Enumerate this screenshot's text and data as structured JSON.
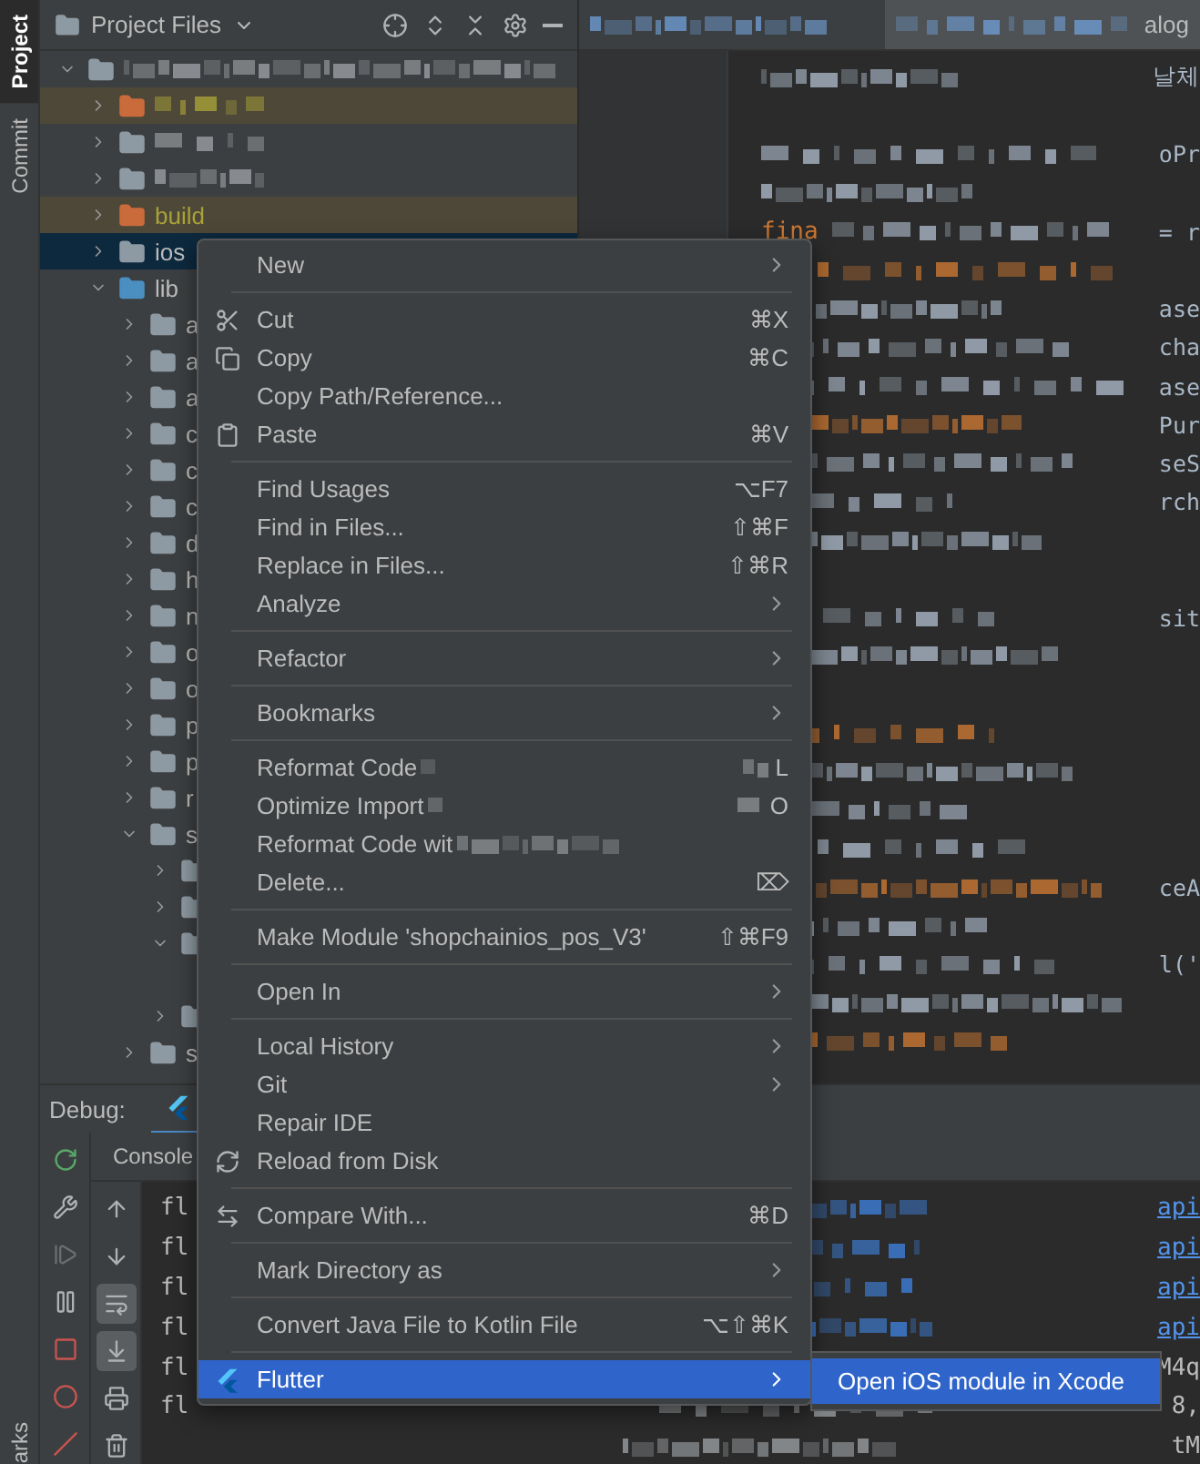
{
  "tool_stripe": {
    "tabs": [
      {
        "label": "Project",
        "selected": true
      },
      {
        "label": "Commit",
        "selected": false
      }
    ],
    "bottom_tab": "arks"
  },
  "project_panel": {
    "title": "Project Files",
    "tree": [
      {
        "expanded": true,
        "selected": false,
        "excluded": false,
        "children": [
          {
            "expanded": false,
            "selected": false,
            "excluded": true
          },
          {
            "expanded": false,
            "selected": false,
            "excluded": false
          },
          {
            "expanded": false,
            "selected": false,
            "excluded": false
          },
          {
            "name": "build",
            "expanded": false,
            "selected": false,
            "excluded": true
          },
          {
            "name": "ios",
            "expanded": false,
            "selected": true,
            "excluded": false
          },
          {
            "name": "lib",
            "expanded": true,
            "selected": false,
            "excluded": false,
            "children": [
              {
                "name": "a",
                "expanded": false,
                "selected": false,
                "excluded": false
              },
              {
                "name": "a",
                "expanded": false,
                "selected": false,
                "excluded": false
              },
              {
                "name": "a",
                "expanded": false,
                "selected": false,
                "excluded": false
              },
              {
                "name": "c",
                "expanded": false,
                "selected": false,
                "excluded": false
              },
              {
                "name": "c",
                "expanded": false,
                "selected": false,
                "excluded": false
              },
              {
                "name": "c",
                "expanded": false,
                "selected": false,
                "excluded": false
              },
              {
                "name": "d",
                "expanded": false,
                "selected": false,
                "excluded": false
              },
              {
                "name": "h",
                "expanded": false,
                "selected": false,
                "excluded": false
              },
              {
                "name": "n",
                "expanded": false,
                "selected": false,
                "excluded": false
              },
              {
                "name": "o",
                "expanded": false,
                "selected": false,
                "excluded": false
              },
              {
                "name": "o",
                "expanded": false,
                "selected": false,
                "excluded": false
              },
              {
                "name": "p",
                "expanded": false,
                "selected": false,
                "excluded": false
              },
              {
                "name": "p",
                "expanded": false,
                "selected": false,
                "excluded": false
              },
              {
                "name": "r",
                "expanded": false,
                "selected": false,
                "excluded": false
              },
              {
                "name": "s",
                "expanded": true,
                "selected": false,
                "excluded": false,
                "children": [
                  {
                    "expanded": false,
                    "selected": false,
                    "excluded": false
                  },
                  {
                    "expanded": false,
                    "selected": false,
                    "excluded": false
                  },
                  {
                    "expanded": true,
                    "selected": false,
                    "excluded": false
                  },
                  {
                    "expanded": false,
                    "selected": false,
                    "excluded": false
                  }
                ]
              },
              {
                "name": "s",
                "expanded": false,
                "selected": false,
                "excluded": false
              }
            ]
          }
        ]
      }
    ]
  },
  "editor": {
    "tabs": [
      {
        "selected": false
      },
      {
        "selected": true,
        "tail": "alog"
      }
    ],
    "lines": [
      {
        "kind": "code",
        "tail": "날체"
      },
      {
        "kind": "blank"
      },
      {
        "kind": "code",
        "tail": "oPr"
      },
      {
        "kind": "blurred"
      },
      {
        "kind": "code",
        "text": "fina",
        "tail": "= r"
      },
      {
        "kind": "blurred"
      },
      {
        "kind": "code",
        "tail": "ase"
      },
      {
        "kind": "code",
        "tail": "cha"
      },
      {
        "kind": "code",
        "tail": "ase"
      },
      {
        "kind": "code",
        "tail": "Pur"
      },
      {
        "kind": "code",
        "tail": "seS"
      },
      {
        "kind": "code",
        "tail": "rch"
      },
      {
        "kind": "blurred"
      },
      {
        "kind": "blank"
      },
      {
        "kind": "code",
        "tail": "sit"
      },
      {
        "kind": "blurred"
      },
      {
        "kind": "blank"
      },
      {
        "kind": "blurred"
      },
      {
        "kind": "blurred"
      },
      {
        "kind": "blurred"
      },
      {
        "kind": "blurred"
      },
      {
        "kind": "code",
        "tail": "ceA"
      },
      {
        "kind": "blurred"
      },
      {
        "kind": "code",
        "tail": "l('"
      },
      {
        "kind": "blurred"
      },
      {
        "kind": "blurred"
      }
    ]
  },
  "debug": {
    "title": "Debug:",
    "console_tab": "Console",
    "console_toolbar": [
      {
        "on": false
      },
      {
        "on": false
      },
      {
        "on": true
      },
      {
        "on": true
      },
      {
        "on": false
      },
      {
        "on": false
      }
    ],
    "lines": [
      {
        "text": "fl",
        "tail": "api",
        "link": true
      },
      {
        "text": "fl",
        "tail": "api",
        "link": true
      },
      {
        "text": "fl",
        "tail": "api",
        "link": true
      },
      {
        "text": "fl",
        "tail": "api",
        "link": true
      },
      {
        "text": "fl",
        "tail": "M4q",
        "link": false
      },
      {
        "text": "fl",
        "tail": "8,",
        "link": false
      },
      {
        "tail": "tM",
        "link": false
      }
    ]
  },
  "context_menu": [
    {
      "kind": "item",
      "label": "New",
      "submenu": true,
      "selected": false
    },
    {
      "kind": "separator"
    },
    {
      "kind": "item",
      "label": "Cut",
      "shortcut": "⌘X",
      "submenu": false,
      "selected": false
    },
    {
      "kind": "item",
      "label": "Copy",
      "shortcut": "⌘C",
      "submenu": false,
      "selected": false
    },
    {
      "kind": "item",
      "label": "Copy Path/Reference...",
      "submenu": false,
      "selected": false
    },
    {
      "kind": "item",
      "label": "Paste",
      "shortcut": "⌘V",
      "submenu": false,
      "selected": false
    },
    {
      "kind": "separator"
    },
    {
      "kind": "item",
      "label": "Find Usages",
      "shortcut": "⌥F7",
      "submenu": false,
      "selected": false
    },
    {
      "kind": "item",
      "label": "Find in Files...",
      "shortcut": "⇧⌘F",
      "submenu": false,
      "selected": false
    },
    {
      "kind": "item",
      "label": "Replace in Files...",
      "shortcut": "⇧⌘R",
      "submenu": false,
      "selected": false
    },
    {
      "kind": "item",
      "label": "Analyze",
      "submenu": true,
      "selected": false
    },
    {
      "kind": "separator"
    },
    {
      "kind": "item",
      "label": "Refactor",
      "submenu": true,
      "selected": false
    },
    {
      "kind": "separator"
    },
    {
      "kind": "item",
      "label": "Bookmarks",
      "submenu": true,
      "selected": false
    },
    {
      "kind": "separator"
    },
    {
      "kind": "item",
      "label": "Reformat Code",
      "shortcut": "L",
      "obscured": true,
      "submenu": false,
      "selected": false
    },
    {
      "kind": "item",
      "label": "Optimize Import",
      "shortcut": "O",
      "obscured": true,
      "submenu": false,
      "selected": false
    },
    {
      "kind": "item",
      "label": "Reformat Code wit",
      "obscured": true,
      "submenu": false,
      "selected": false
    },
    {
      "kind": "item",
      "label": "Delete...",
      "shortcut": "⌦",
      "submenu": false,
      "selected": false
    },
    {
      "kind": "separator"
    },
    {
      "kind": "item",
      "label": "Make Module 'shopchainios_pos_V3'",
      "shortcut": "⇧⌘F9",
      "submenu": false,
      "selected": false
    },
    {
      "kind": "separator"
    },
    {
      "kind": "item",
      "label": "Open In",
      "submenu": true,
      "selected": false
    },
    {
      "kind": "separator"
    },
    {
      "kind": "item",
      "label": "Local History",
      "submenu": true,
      "selected": false
    },
    {
      "kind": "item",
      "label": "Git",
      "submenu": true,
      "selected": false
    },
    {
      "kind": "item",
      "label": "Repair IDE",
      "submenu": false,
      "selected": false
    },
    {
      "kind": "item",
      "label": "Reload from Disk",
      "submenu": false,
      "selected": false
    },
    {
      "kind": "separator"
    },
    {
      "kind": "item",
      "label": "Compare With...",
      "shortcut": "⌘D",
      "submenu": false,
      "selected": false
    },
    {
      "kind": "separator"
    },
    {
      "kind": "item",
      "label": "Mark Directory as",
      "submenu": true,
      "selected": false
    },
    {
      "kind": "separator"
    },
    {
      "kind": "item",
      "label": "Convert Java File to Kotlin File",
      "shortcut": "⌥⇧⌘K",
      "submenu": false,
      "selected": false
    },
    {
      "kind": "separator"
    },
    {
      "kind": "item",
      "label": "Flutter",
      "submenu": true,
      "selected": true
    }
  ],
  "submenu": [
    {
      "label": "Open iOS module in Xcode",
      "selected": true
    }
  ]
}
